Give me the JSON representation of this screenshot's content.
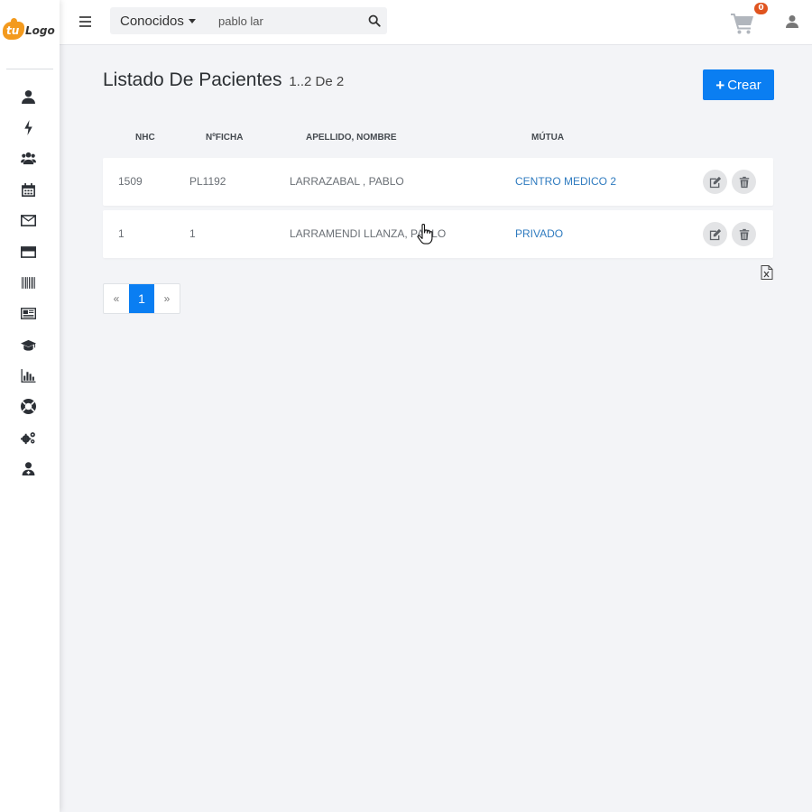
{
  "brand": {
    "logo_part1": "tu",
    "logo_part2": "Logo"
  },
  "topbar": {
    "dropdown_label": "Conocidos",
    "search_value": "pablo lar",
    "cart_count": "0"
  },
  "page": {
    "title": "Listado De Pacientes",
    "range": "1..2 De 2",
    "create_label": "Crear"
  },
  "table": {
    "headers": [
      "NHC",
      "NºFICHA",
      "APELLIDO, NOMBRE",
      "MÚTUA"
    ],
    "rows": [
      {
        "nhc": "1509",
        "ficha": "PL1192",
        "nombre": "LARRAZABAL , PABLO",
        "mutua": "CENTRO MEDICO 2"
      },
      {
        "nhc": "1",
        "ficha": "1",
        "nombre": "LARRAMENDI LLANZA, PABLO",
        "mutua": "PRIVADO"
      }
    ]
  },
  "pagination": {
    "prev": "«",
    "current": "1",
    "next": "»"
  },
  "sidebar_icons": [
    "user-icon",
    "bolt-icon",
    "users-icon",
    "calendar-icon",
    "envelope-icon",
    "credit-card-icon",
    "barcode-icon",
    "newspaper-icon",
    "graduation-cap-icon",
    "bar-chart-icon",
    "life-ring-icon",
    "cogs-icon",
    "user-doctor-icon"
  ],
  "colors": {
    "accent": "#0a7ef2",
    "link": "#2f7bbf",
    "badge": "#e0541f",
    "logo": "#f39a1e"
  }
}
